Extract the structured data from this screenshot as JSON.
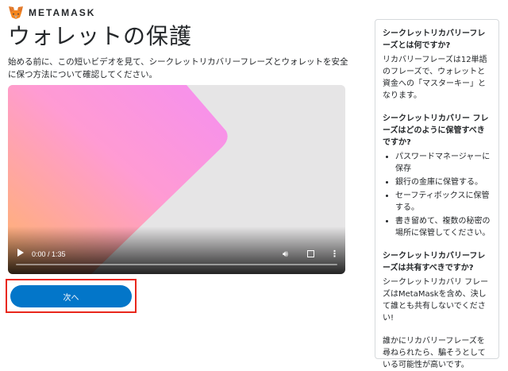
{
  "brand": {
    "name": "METAMASK",
    "logo_icon": "fox-logo-icon"
  },
  "page": {
    "title": "ウォレットの保護",
    "intro": "始める前に、この短いビデオを見て、シークレットリカバリーフレーズとウォレットを安全に保つ方法について確認してください。"
  },
  "video": {
    "time": "0:00 / 1:35",
    "progress": 0,
    "icons": [
      "play-icon",
      "volume-icon",
      "fullscreen-icon",
      "more-options-icon"
    ]
  },
  "actions": {
    "next_label": "次へ"
  },
  "sidebar": {
    "q1": "シークレットリカバリーフレーズとは何ですか?",
    "a1": "リカバリーフレーズは12単語のフレーズで、ウォレットと資金への「マスターキー」となります。",
    "q2": "シークレットリカバリー フレーズはどのように保管すべきですか?",
    "tips": [
      "パスワードマネージャーに保存",
      "銀行の金庫に保管する。",
      "セーフティボックスに保管する。",
      "書き留めて、複数の秘密の場所に保管してください。"
    ],
    "q3": "シークレットリカバリーフレーズは共有すべきですか?",
    "a3": "シークレットリカバリ フレーズはMetaMaskを含め、決して誰とも共有しないでください!",
    "warning": "誰かにリカバリーフレーズを尋ねられたら、騙そうとしている可能性が高いです。"
  },
  "colors": {
    "accent": "#0376c9",
    "highlight": "#e8271c"
  }
}
